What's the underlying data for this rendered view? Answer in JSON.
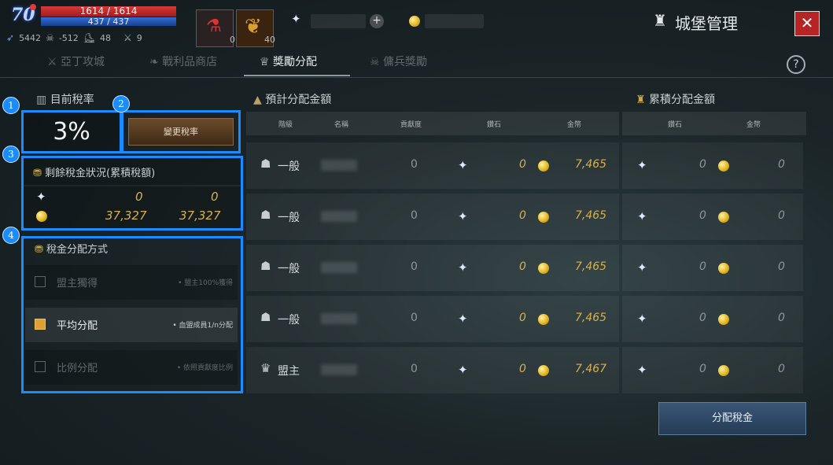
{
  "hud": {
    "level": "70",
    "hp": "1614 / 1614",
    "mp": "437 / 437",
    "stat1": "5442",
    "stat2": "-512",
    "stat3": "48",
    "stat4": "9",
    "potion_count": "0",
    "leaf_count": "40"
  },
  "window": {
    "title": "城堡管理",
    "close_label": "✕",
    "help_label": "?"
  },
  "tabs": [
    {
      "label": "亞丁攻城"
    },
    {
      "label": "戰利品商店"
    },
    {
      "label": "獎勵分配"
    },
    {
      "label": "傭兵獎勵"
    }
  ],
  "left": {
    "rate_header": "目前稅率",
    "rate_value": "3%",
    "change_button": "變更稅率",
    "remain_header": "剩餘稅金狀況(累積稅額)",
    "remain_crystal_a": "0",
    "remain_crystal_b": "0",
    "remain_gold_a": "37,327",
    "remain_gold_b": "37,327",
    "dist_header": "稅金分配方式",
    "options": [
      {
        "label": "盟主獨得",
        "note": "• 盟主100%獲得"
      },
      {
        "label": "平均分配",
        "note": "• 血盟成員1/n分配"
      },
      {
        "label": "比例分配",
        "note": "• 依照貢獻度比例"
      }
    ]
  },
  "badges": [
    "1",
    "2",
    "3",
    "4"
  ],
  "right": {
    "est_header": "預計分配金額",
    "acc_header": "累積分配金額",
    "cols": [
      "階級",
      "名稱",
      "貢獻度",
      "鑽石",
      "金幣",
      "鑽石",
      "金幣"
    ],
    "rows": [
      {
        "rank": "一般",
        "contrib": "0",
        "dia": "0",
        "gold": "7,465",
        "acc_dia": "0",
        "acc_gold": "0"
      },
      {
        "rank": "一般",
        "contrib": "0",
        "dia": "0",
        "gold": "7,465",
        "acc_dia": "0",
        "acc_gold": "0"
      },
      {
        "rank": "一般",
        "contrib": "0",
        "dia": "0",
        "gold": "7,465",
        "acc_dia": "0",
        "acc_gold": "0"
      },
      {
        "rank": "一般",
        "contrib": "0",
        "dia": "0",
        "gold": "7,465",
        "acc_dia": "0",
        "acc_gold": "0"
      },
      {
        "rank": "盟主",
        "contrib": "0",
        "dia": "0",
        "gold": "7,467",
        "acc_dia": "0",
        "acc_gold": "0"
      }
    ],
    "distribute_button": "分配稅金"
  },
  "icons": {
    "crystal": "crystal-icon",
    "coin": "gold-coin-icon",
    "helmet": "helmet-icon",
    "crown": "crown-icon"
  }
}
